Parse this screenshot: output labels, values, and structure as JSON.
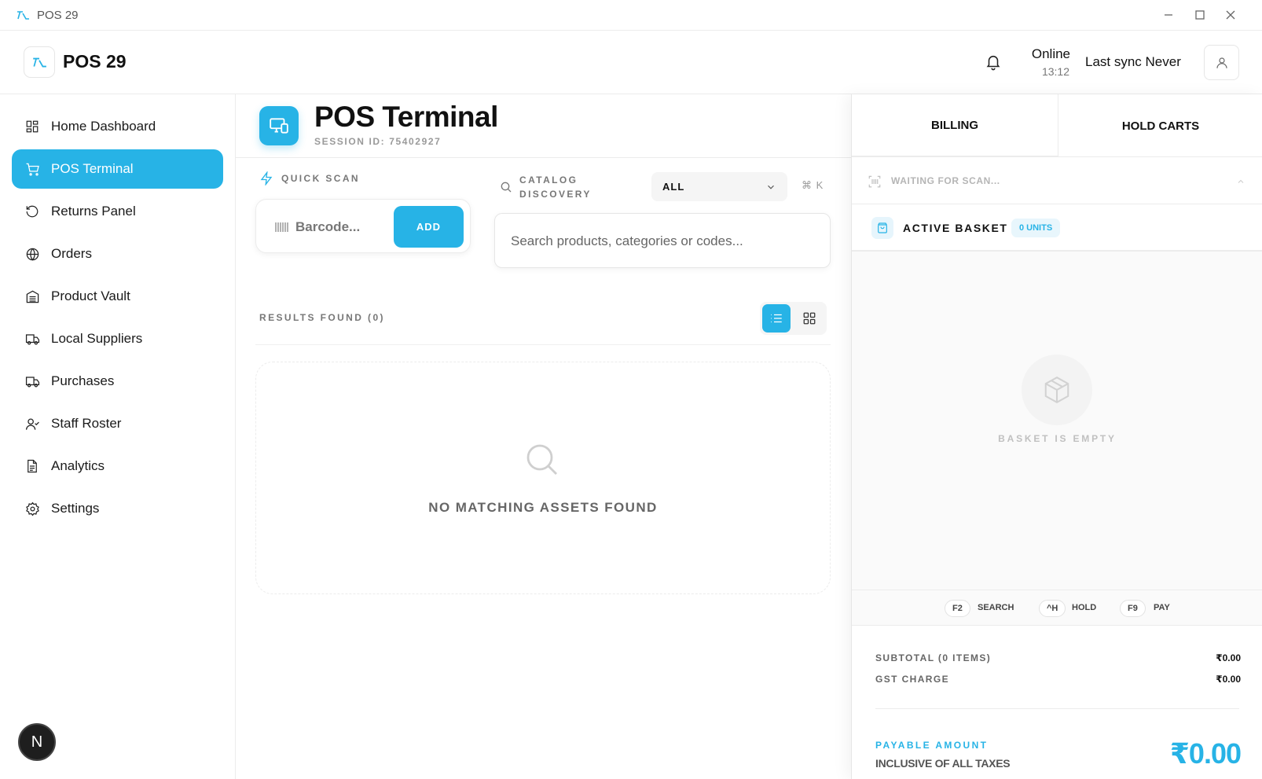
{
  "window": {
    "title": "POS 29"
  },
  "header": {
    "app_name": "POS 29",
    "status": "Online",
    "time": "13:12",
    "sync": "Last sync Never"
  },
  "sidebar": {
    "items": [
      {
        "label": "Home Dashboard",
        "icon": "dashboard-icon"
      },
      {
        "label": "POS Terminal",
        "icon": "cart-icon",
        "active": true
      },
      {
        "label": "Returns Panel",
        "icon": "undo-icon"
      },
      {
        "label": "Orders",
        "icon": "globe-icon"
      },
      {
        "label": "Product Vault",
        "icon": "warehouse-icon"
      },
      {
        "label": "Local Suppliers",
        "icon": "truck-icon"
      },
      {
        "label": "Purchases",
        "icon": "truck-icon"
      },
      {
        "label": "Staff Roster",
        "icon": "user-check-icon"
      },
      {
        "label": "Analytics",
        "icon": "document-icon"
      },
      {
        "label": "Settings",
        "icon": "gear-icon"
      }
    ],
    "avatar_letter": "N"
  },
  "main": {
    "title": "POS Terminal",
    "session_id": "SESSION ID: 75402927",
    "quick_scan": {
      "label": "QUICK SCAN",
      "placeholder": "Barcode...",
      "add_label": "ADD"
    },
    "catalog": {
      "label": "CATALOG DISCOVERY",
      "filter_value": "ALL",
      "shortcut": "⌘ K",
      "search_placeholder": "Search products, categories or codes..."
    },
    "results_label": "RESULTS FOUND (0)",
    "empty_text": "NO MATCHING ASSETS FOUND"
  },
  "cart": {
    "tabs": {
      "billing": "BILLING",
      "hold": "HOLD CARTS"
    },
    "scan_status": "WAITING FOR SCAN...",
    "basket_title": "ACTIVE BASKET",
    "units": "0 UNITS",
    "empty_text": "BASKET IS EMPTY",
    "shortcuts": [
      {
        "key": "F2",
        "action": "SEARCH"
      },
      {
        "key": "^H",
        "action": "HOLD"
      },
      {
        "key": "F9",
        "action": "PAY"
      }
    ],
    "subtotal_label": "SUBTOTAL (0 ITEMS)",
    "subtotal_value": "₹0.00",
    "gst_label": "GST CHARGE",
    "gst_value": "₹0.00",
    "payable_label": "PAYABLE AMOUNT",
    "inclusive_label": "INCLUSIVE OF ALL TAXES",
    "payable_value": "₹0.00"
  },
  "colors": {
    "accent": "#27b3e6"
  }
}
